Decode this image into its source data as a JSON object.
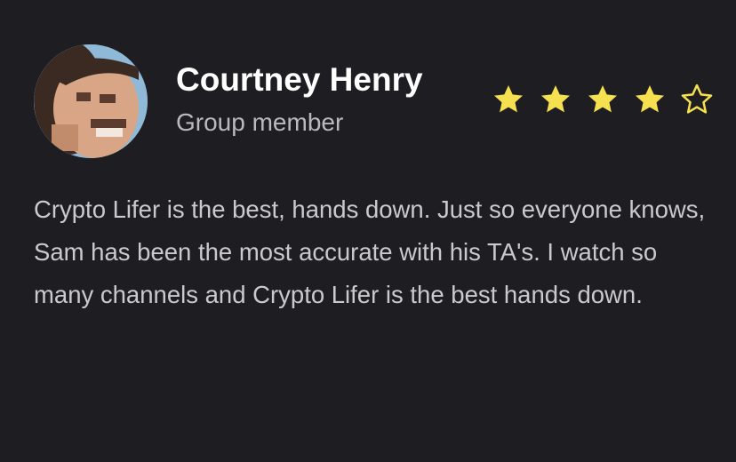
{
  "review": {
    "author_name": "Courtney Henry",
    "author_role": "Group member",
    "rating": 4,
    "rating_max": 5,
    "body": "Crypto Lifer is the best, hands down. Just so everyone knows, Sam has been the most accurate with his TA's. I watch so many channels and Crypto Lifer is the best hands down."
  },
  "colors": {
    "background": "#1e1e22",
    "name": "#ffffff",
    "role": "#b9b9bf",
    "body": "#c9c9ce",
    "star_filled": "#f5e04f",
    "star_outline": "#f5e04f"
  },
  "icons": {
    "avatar": "user-avatar-photo",
    "star_filled": "star-filled-icon",
    "star_empty": "star-outline-icon"
  }
}
